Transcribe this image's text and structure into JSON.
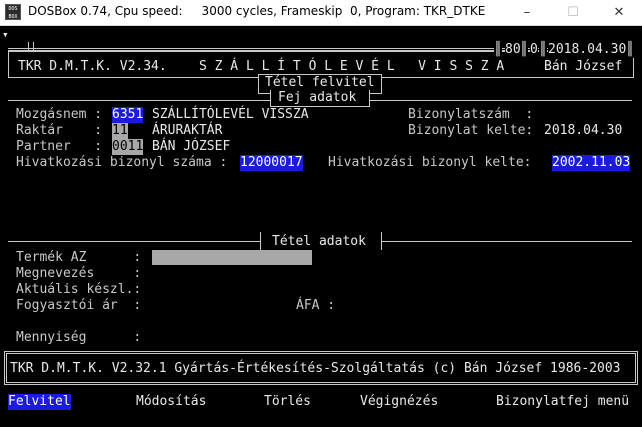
{
  "window": {
    "icon_text": "DOS BOX",
    "title": "DOSBox 0.74, Cpu speed:     3000 cycles, Frameskip  0, Program: TKR_DTKE",
    "minimize": "–",
    "maximize": "☐",
    "close": "✕"
  },
  "header": {
    "counter1": "80",
    "counter2": "0",
    "date": "2018.04.30",
    "app_title": "TKR D.M.T.K. V2.34.",
    "doc_title": "S Z Á L L Í T Ó L E V É L   V I S S Z A",
    "user": "Bán József",
    "mode_title": "Tétel felvitel"
  },
  "head_section": {
    "title": "Fej adatok",
    "mozgasnem_label": "Mozgásnem :",
    "mozgasnem_code": "6351",
    "mozgasnem_name": "SZÁLLÍTÓLEVÉL VISSZA",
    "raktar_label": "Raktár    :",
    "raktar_code": "11",
    "raktar_name": "ÁRURAKTÁR",
    "partner_label": "Partner   :",
    "partner_code": "0011",
    "partner_name": "BÁN JÓZSEF",
    "hivatkozasi_szam_label": "Hivatkozási bizonyl száma :",
    "hivatkozasi_szam": "12000017",
    "hivatkozasi_kelte_label": "Hivatkozási bizonyl kelte:",
    "hivatkozasi_kelte": "2002.11.03",
    "bizonylatszam_label": "Bizonylatszám  :",
    "bizonylat_kelte_label": "Bizonylat kelte:",
    "bizonylat_kelte": "2018.04.30"
  },
  "item_section": {
    "title": "Tétel adatok",
    "termek_label": "Termék AZ      :",
    "megnevezes_label": "Megnevezés     :",
    "aktualis_label": "Aktuális készl.:",
    "fogyasztoi_label": "Fogyasztói ár  :",
    "afa_label": "ÁFA :",
    "mennyiseg_label": "Mennyiség      :"
  },
  "footer": {
    "copyright": "TKR D.M.T.K. V2.32.1 Gyártás-Értékesítés-Szolgáltatás (c) Bán József 1986-2003"
  },
  "menu": {
    "items": [
      "Felvitel",
      "Módosítás",
      "Törlés",
      "Végignézés",
      "Bizonylatfej menü"
    ]
  }
}
